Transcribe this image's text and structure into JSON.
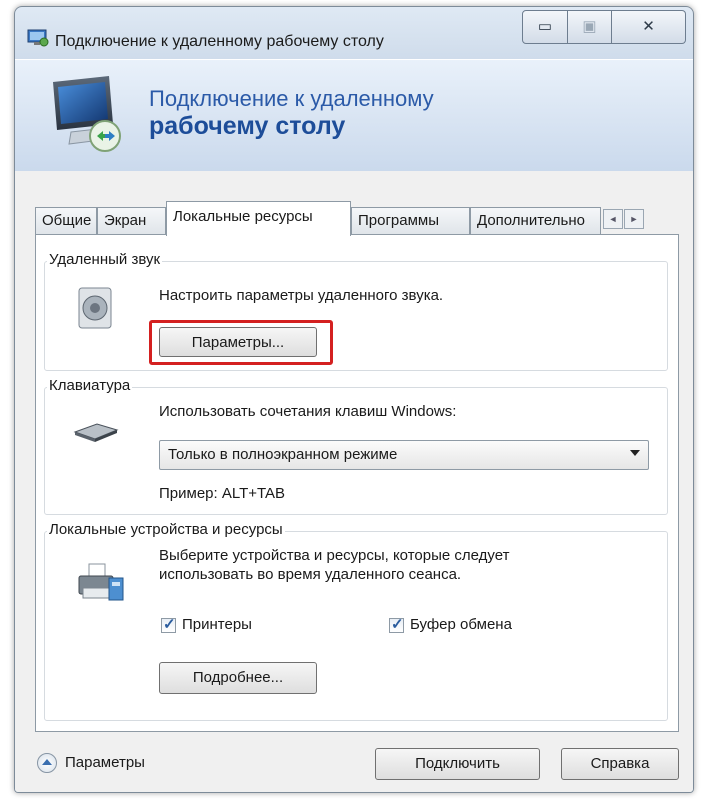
{
  "window": {
    "title": "Подключение к удаленному рабочему столу",
    "minimize_glyph": "▭",
    "maximize_glyph": "▣",
    "close_glyph": "✕"
  },
  "banner": {
    "line1": "Подключение к удаленному",
    "line2": "рабочему столу"
  },
  "tabs": [
    {
      "label": "Общие"
    },
    {
      "label": "Экран"
    },
    {
      "label": "Локальные ресурсы",
      "active": true
    },
    {
      "label": "Программы"
    },
    {
      "label": "Дополнительно"
    }
  ],
  "tab_scroll": {
    "left": "◄",
    "right": "►"
  },
  "remote_audio": {
    "group_label": "Удаленный звук",
    "description": "Настроить параметры удаленного звука.",
    "button_label": "Параметры..."
  },
  "keyboard": {
    "group_label": "Клавиатура",
    "description": "Использовать сочетания клавиш Windows:",
    "selected_option": "Только в полноэкранном режиме",
    "example": "Пример: ALT+TAB"
  },
  "local_devices": {
    "group_label": "Локальные устройства и ресурсы",
    "description_line1": "Выберите устройства и ресурсы, которые следует",
    "description_line2": "использовать во время удаленного сеанса.",
    "printers_label": "Принтеры",
    "printers_checked": true,
    "clipboard_label": "Буфер обмена",
    "clipboard_checked": true,
    "more_button_label": "Подробнее..."
  },
  "footer": {
    "options_label": "Параметры",
    "connect_label": "Подключить",
    "help_label": "Справка"
  },
  "colors": {
    "highlight": "#d42020",
    "banner_text": "#1d4d99"
  }
}
